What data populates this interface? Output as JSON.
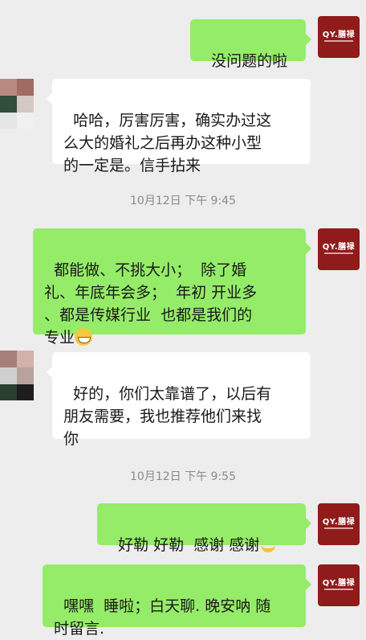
{
  "messages": [
    {
      "side": "right",
      "text": "没问题的啦"
    },
    {
      "side": "left",
      "text": "哈哈，厉害厉害，确实办过这\n么大的婚礼之后再办这种小型\n的一定是。信手拈来"
    },
    {
      "side": "right",
      "text": "都能做、不挑大小；  除了婚\n礼、年底年会多；  年初 开业多\n、都是传媒行业  也都是我们的\n专业"
    },
    {
      "side": "left",
      "text": "好的，你们太靠谱了，以后有\n朋友需要，我也推荐他们来找\n你"
    },
    {
      "side": "right",
      "text": "好勒 好勒  感谢 感谢"
    },
    {
      "side": "right",
      "text": "嘿嘿  睡啦；白天聊. 晚安呐 随\n时留言."
    }
  ],
  "timestamps": [
    "10月12日 下午 9:45",
    "10月12日 下午 9:55"
  ],
  "avatar_right": {
    "logo_text": "QY.膳禄",
    "bg": "#8f1b1b"
  },
  "colors": {
    "outgoing_bubble": "#95ec69",
    "incoming_bubble": "#ffffff",
    "background": "#ededed",
    "timestamp": "#8a8a8a"
  },
  "emojis": [
    "grinning-face-emoji",
    "banana-emoji"
  ]
}
